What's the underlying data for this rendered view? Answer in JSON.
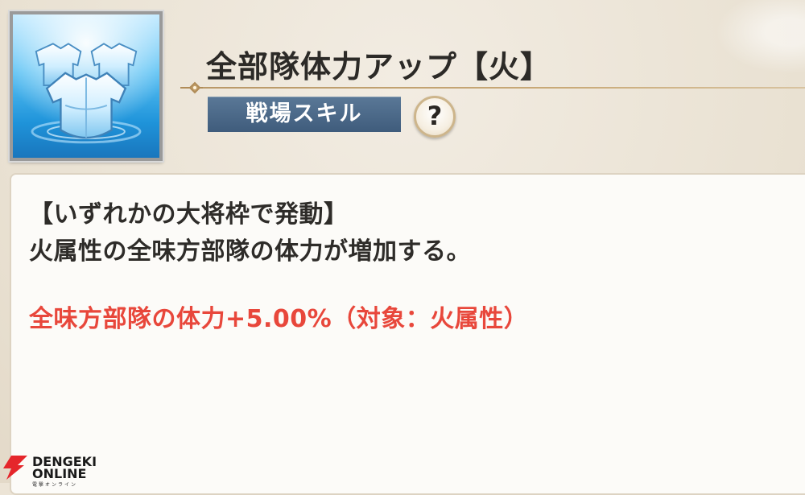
{
  "skill": {
    "title": "全部隊体力アップ【火】",
    "category": "戦場スキル",
    "help_label": "?",
    "icon": "armor-buff-icon"
  },
  "description": {
    "condition": "【いずれかの大将枠で発動】",
    "summary": "火属性の全味方部隊の体力が増加する。",
    "effect": "全味方部隊の体力+5.00%（対象：火属性）"
  },
  "watermark": {
    "line1": "DENGEKI",
    "line2": "ONLINE",
    "kana": "電撃オンライン"
  },
  "colors": {
    "badge": "#46647f",
    "effect_text": "#e8473b",
    "icon_background": "#2a9be0"
  }
}
